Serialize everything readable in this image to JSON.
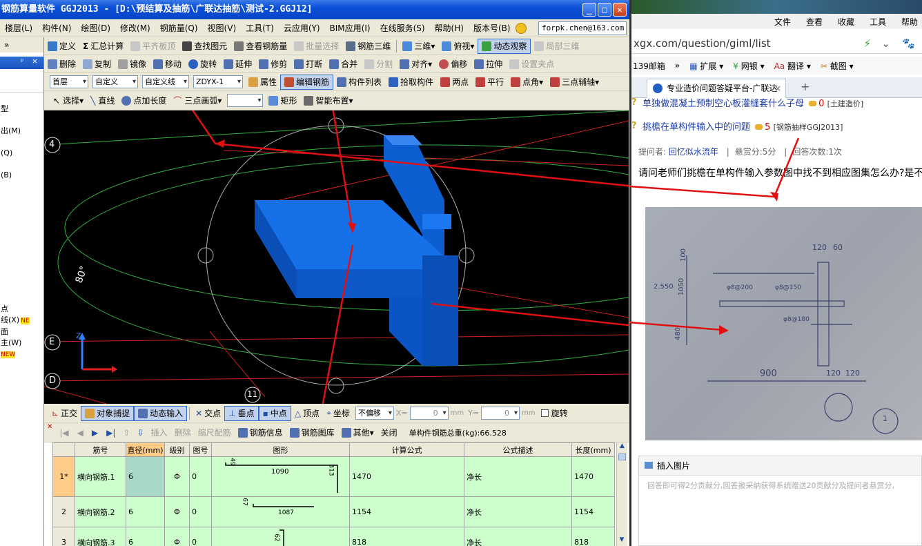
{
  "window": {
    "title": "钢筋算量软件 GGJ2013 - [D:\\预结算及抽筋\\广联达抽筋\\测试-2.GGJ12]",
    "account": "forpk.chen@163.com"
  },
  "menu": [
    "楼层(L)",
    "构件(N)",
    "绘图(D)",
    "修改(M)",
    "钢筋量(Q)",
    "视图(V)",
    "工具(T)",
    "云应用(Y)",
    "BIM应用(I)",
    "在线服务(S)",
    "帮助(H)",
    "版本号(B)"
  ],
  "toolbar1": [
    "定义",
    "汇总计算",
    "平齐板顶",
    "查找图元",
    "查看钢筋量",
    "批量选择",
    "钢筋三维",
    "三维",
    "俯视",
    "动态观察",
    "局部三维"
  ],
  "toolbar2": [
    "删除",
    "复制",
    "镜像",
    "移动",
    "旋转",
    "延伸",
    "修剪",
    "打断",
    "合并",
    "分割",
    "对齐",
    "偏移",
    "拉伸",
    "设置夹点"
  ],
  "toolbar3": {
    "floor": "首层",
    "type": "自定义",
    "subtype": "自定义线",
    "code": "ZDYX-1",
    "buttons": [
      "属性",
      "编辑钢筋",
      "构件列表",
      "拾取构件",
      "两点",
      "平行",
      "点角",
      "三点辅轴"
    ]
  },
  "toolbar4": [
    "选择",
    "直线",
    "点加长度",
    "三点画弧",
    "矩形",
    "智能布置"
  ],
  "left_tree": [
    "型",
    "出(M)",
    "(Q)",
    "(B)",
    "点",
    "线(X)",
    "面",
    "主(W)"
  ],
  "left_new_badges": [
    "NE",
    "NEW"
  ],
  "viewport": {
    "axis_labels": [
      "4",
      "E",
      "D",
      "11"
    ],
    "angle": "80°",
    "axis_z": "Z"
  },
  "snap_bar": {
    "items": [
      "正交",
      "对象捕捉",
      "动态输入",
      "交点",
      "垂点",
      "中点",
      "顶点",
      "坐标"
    ],
    "offset": "不偏移",
    "x_label": "X=",
    "x_value": "0",
    "y_label": "Y=",
    "y_value": "0",
    "unit": "mm",
    "rotate": "旋转"
  },
  "rebar_bar": {
    "items": [
      "插入",
      "删除",
      "缩尺配筋",
      "钢筋信息",
      "钢筋图库",
      "其他",
      "关闭"
    ],
    "total_weight": "单构件钢筋总重(kg):66.528"
  },
  "rebar_table": {
    "headers": [
      "筋号",
      "直径(mm)",
      "级别",
      "图号",
      "图形",
      "计算公式",
      "公式描述",
      "长度(mm)"
    ],
    "rows": [
      {
        "idx": "1*",
        "name": "横向钢筋.1",
        "dia": "6",
        "grade": "Φ",
        "fig": "0",
        "shape_a": "49",
        "shape_b": "1090",
        "shape_c": "313",
        "formula": "1470",
        "desc": "净长",
        "length": "1470"
      },
      {
        "idx": "2",
        "name": "横向钢筋.2",
        "dia": "6",
        "grade": "Φ",
        "fig": "0",
        "shape_a": "67",
        "shape_b": "1087",
        "shape_c": "",
        "formula": "1154",
        "desc": "净长",
        "length": "1154"
      },
      {
        "idx": "3",
        "name": "横向钢筋.3",
        "dia": "6",
        "grade": "Φ",
        "fig": "0",
        "shape_a": "62",
        "shape_b": "",
        "shape_c": "",
        "formula": "818",
        "desc": "净长",
        "length": "818"
      }
    ]
  },
  "browser": {
    "menu": [
      "文件",
      "查看",
      "收藏",
      "工具",
      "帮助"
    ],
    "url": "xgx.com/question/giml/list",
    "favorites": [
      "139邮箱",
      "扩展",
      "网银",
      "翻译",
      "截图"
    ],
    "tab_title": "专业造价问题答疑平台-广联达",
    "questions": [
      {
        "title": "单独做混凝土预制空心板灌缝套什么子母",
        "score": "0",
        "tag": "[土建造价]"
      },
      {
        "title": "挑檐在单构件输入中的问题",
        "score": "5",
        "tag": "[钢筋抽样GGJ2013]"
      }
    ],
    "meta": {
      "asker_label": "提问者:",
      "asker": "回忆似水流年",
      "reward": "悬赏分:5分",
      "answers": "回答次数:1次"
    },
    "question_text": "请问老师们挑檐在单构件输入参数图中找不到相应图集怎么办?是不",
    "photo_labels": [
      "120",
      "60",
      "100",
      "2.550",
      "1050",
      "480",
      "φ8@200",
      "φ8@150",
      "φ8@180",
      "900",
      "120",
      "120",
      "1"
    ],
    "insert_image": "插入图片",
    "answer_placeholder": "回答即可得2分贡献分,回答被采纳获得系统赠送20贡献分及提问者悬赏分,"
  }
}
